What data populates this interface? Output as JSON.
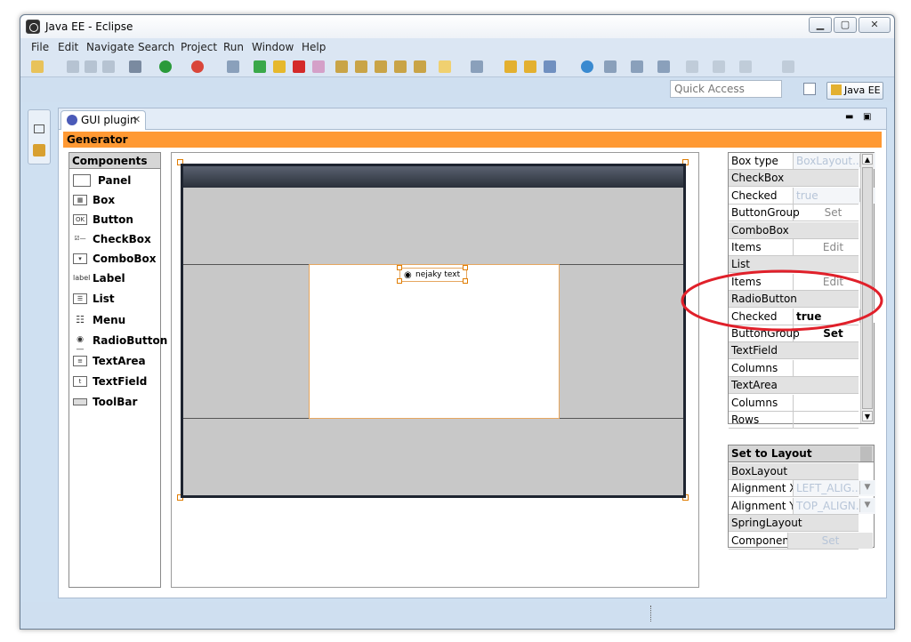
{
  "window": {
    "title": "Java EE - Eclipse"
  },
  "menu": [
    "File",
    "Edit",
    "Navigate",
    "Search",
    "Project",
    "Run",
    "Window",
    "Help"
  ],
  "toolbar": {
    "quick_access_placeholder": "Quick Access",
    "perspective": "Java EE"
  },
  "editor": {
    "tab_label": "GUI plugin",
    "generator_label": "Generator",
    "components_header": "Components",
    "components": [
      "Panel",
      "Box",
      "Button",
      "CheckBox",
      "ComboBox",
      "Label",
      "List",
      "Menu",
      "RadioButton",
      "TextArea",
      "TextField",
      "ToolBar"
    ],
    "component_icon_text": {
      "button": "OK",
      "label": "label"
    },
    "radio_text": "nejaky text"
  },
  "properties": {
    "rows": [
      {
        "key": "Box type",
        "value": "BoxLayout...",
        "kind": "dropdown-disabled"
      },
      {
        "key": "CheckBox",
        "kind": "section"
      },
      {
        "key": "Checked",
        "value": "true",
        "kind": "dropdown-disabled"
      },
      {
        "key": "ButtonGroup",
        "value": "Set",
        "kind": "button"
      },
      {
        "key": "ComboBox",
        "kind": "section"
      },
      {
        "key": "Items",
        "value": "Edit",
        "kind": "button"
      },
      {
        "key": "List",
        "kind": "section"
      },
      {
        "key": "Items",
        "value": "Edit",
        "kind": "button"
      },
      {
        "key": "RadioButton",
        "kind": "section"
      },
      {
        "key": "Checked",
        "value": "true",
        "kind": "dropdown-active"
      },
      {
        "key": "ButtonGroup",
        "value": "Set",
        "kind": "button-active"
      },
      {
        "key": "TextField",
        "kind": "section"
      },
      {
        "key": "Columns",
        "value": "",
        "kind": "text"
      },
      {
        "key": "TextArea",
        "kind": "section"
      },
      {
        "key": "Columns",
        "value": "",
        "kind": "text"
      },
      {
        "key": "Rows",
        "value": "",
        "kind": "text"
      }
    ]
  },
  "layout_panel": {
    "header": "Set to Layout",
    "rows": [
      {
        "key": "BoxLayout",
        "kind": "section"
      },
      {
        "key": "Alignment X",
        "value": "LEFT_ALIG...",
        "kind": "dropdown-disabled"
      },
      {
        "key": "Alignment Y",
        "value": "TOP_ALIGN...",
        "kind": "dropdown-disabled"
      },
      {
        "key": "SpringLayout",
        "kind": "section"
      },
      {
        "key": "Component",
        "value": "Set",
        "kind": "button-disabled"
      }
    ]
  },
  "colors": {
    "generator_bar": "#ff9933",
    "highlight_ellipse": "#e0202a",
    "selection": "#e07c00"
  }
}
